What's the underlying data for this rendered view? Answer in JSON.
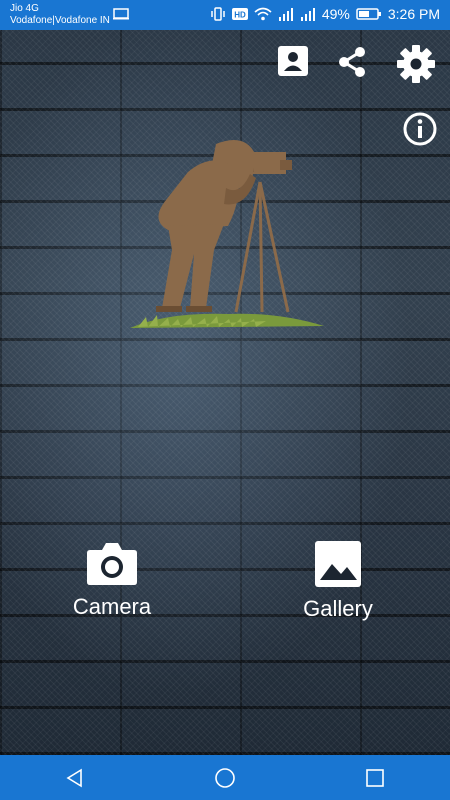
{
  "status_bar": {
    "carrier_line1": "Jio 4G",
    "carrier_line2": "Vodafone|Vodafone IN",
    "battery": "49%",
    "time": "3:26 PM"
  },
  "actions": {
    "camera_label": "Camera",
    "gallery_label": "Gallery"
  },
  "icons": [
    "profile-icon",
    "share-icon",
    "settings-icon",
    "info-icon",
    "camera-icon",
    "gallery-icon",
    "back-icon",
    "home-icon",
    "recents-icon"
  ],
  "colors": {
    "accent": "#1976d2",
    "logo_brown": "#8b6a4a"
  }
}
